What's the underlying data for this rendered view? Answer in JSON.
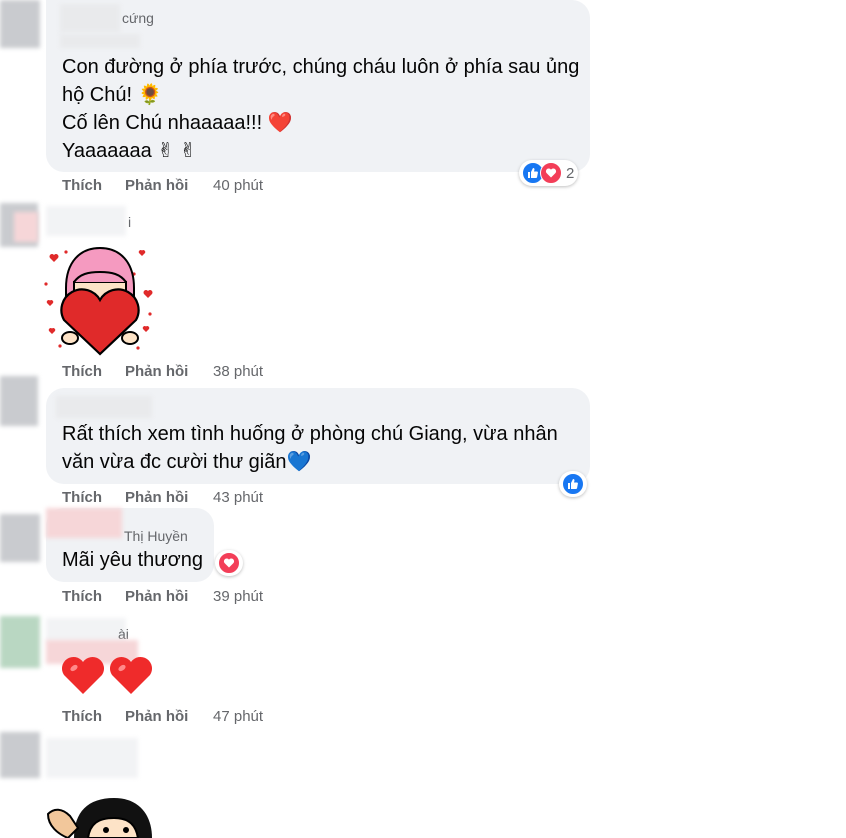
{
  "comments": [
    {
      "name": "cứng",
      "lines": [
        "Con đường ở phía trước, chúng cháu luôn ở phía sau ủng",
        "hộ Chú! 🌻",
        "Cố lên Chú nhaaaaa!!! ❤️",
        "Yaaaaaaa ✌ ✌"
      ],
      "reaction_count": "2",
      "time": "40 phút"
    },
    {
      "name": "i",
      "time": "38 phút"
    },
    {
      "name": "",
      "lines": [
        "Rất thích xem tình huống ở phòng chú Giang, vừa nhân",
        "văn vừa đc cười thư giãn💙"
      ],
      "time": "43 phút"
    },
    {
      "name": "Thị Huyền",
      "lines": [
        "Mãi yêu thương"
      ],
      "time": "39 phút"
    },
    {
      "name": "ài",
      "time": "47 phút"
    }
  ],
  "labels": {
    "like": "Thích",
    "reply": "Phản hồi"
  },
  "colors": {
    "like_blue": "#1877f2",
    "love_red": "#f33e58",
    "text_gray": "#65676b",
    "bubble": "#f0f2f5"
  }
}
